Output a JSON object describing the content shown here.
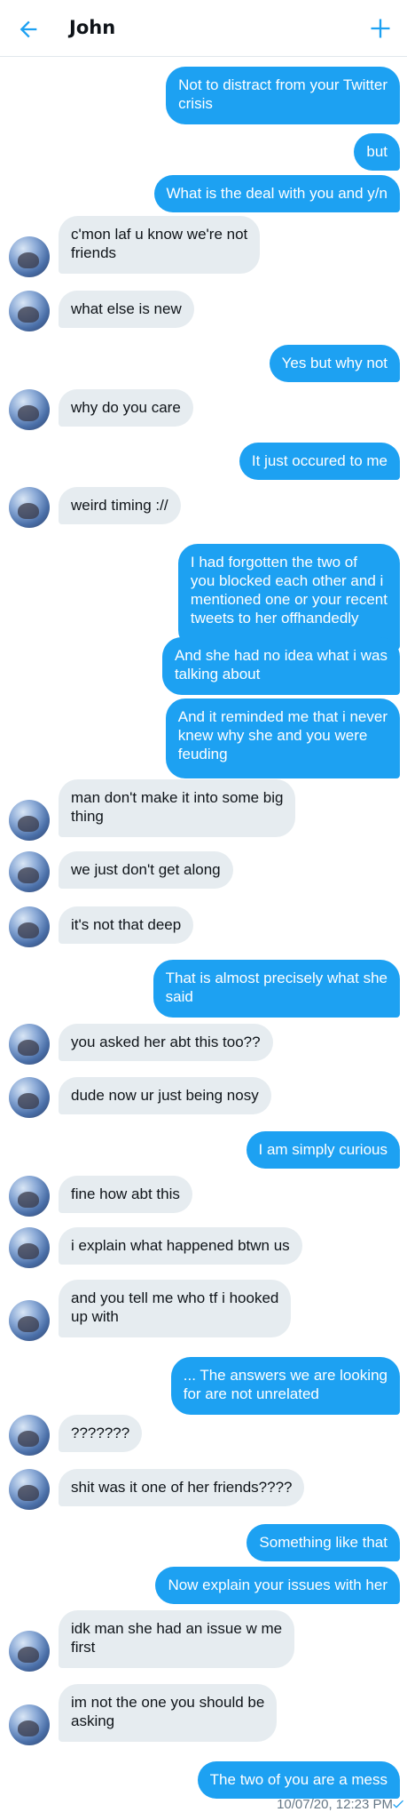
{
  "header": {
    "title": "John",
    "back_icon": "back-arrow-icon",
    "new_icon": "plus-icon",
    "accent": "#1da1f2"
  },
  "messages": [
    {
      "from": "me",
      "text": "Not to distract from your Twitter\ncrisis"
    },
    {
      "from": "me",
      "text": "but"
    },
    {
      "from": "me",
      "text": "What is the deal with you and y/n"
    },
    {
      "from": "john",
      "text": "c'mon laf u know we're not\nfriends"
    },
    {
      "from": "john",
      "text": "what else is new"
    },
    {
      "from": "me",
      "text": "Yes but why not"
    },
    {
      "from": "john",
      "text": "why do you care"
    },
    {
      "from": "me",
      "text": "It just occured to me"
    },
    {
      "from": "john",
      "text": "weird timing ://"
    },
    {
      "from": "me",
      "text": "I had forgotten the two of\nyou blocked each other and i\nmentioned one or your recent\ntweets to her offhandedly"
    },
    {
      "from": "me",
      "text": "And she had no idea what i was\ntalking about"
    },
    {
      "from": "me",
      "text": "And it reminded me that i never\nknew why she and you were\nfeuding"
    },
    {
      "from": "john",
      "text": "man don't make it into some big\nthing"
    },
    {
      "from": "john",
      "text": "we just don't get along"
    },
    {
      "from": "john",
      "text": "it's not that deep"
    },
    {
      "from": "me",
      "text": "That is almost precisely what she\nsaid"
    },
    {
      "from": "john",
      "text": "you asked her abt this too??"
    },
    {
      "from": "john",
      "text": "dude now ur just being nosy"
    },
    {
      "from": "me",
      "text": "I am simply curious"
    },
    {
      "from": "john",
      "text": "fine how abt this"
    },
    {
      "from": "john",
      "text": "i explain what happened btwn us"
    },
    {
      "from": "john",
      "text": "and you tell me who tf i hooked\nup with"
    },
    {
      "from": "me",
      "text": "... The answers we are looking\nfor are not unrelated"
    },
    {
      "from": "john",
      "text": "???????"
    },
    {
      "from": "john",
      "text": "shit was it one of her friends????"
    },
    {
      "from": "me",
      "text": "Something like that"
    },
    {
      "from": "me",
      "text": "Now explain your issues with her"
    },
    {
      "from": "john",
      "text": "idk man she had an issue w me\nfirst"
    },
    {
      "from": "john",
      "text": "im not the one you should be\nasking"
    },
    {
      "from": "me",
      "text": "The two of you are a mess"
    }
  ],
  "footer": {
    "timestamp": "10/07/20, 12:23 PM",
    "read_icon": "checkmark-icon"
  },
  "colors": {
    "sent_bubble": "#1da1f2",
    "received_bubble": "#e6ecf0",
    "timestamp": "#657786"
  }
}
